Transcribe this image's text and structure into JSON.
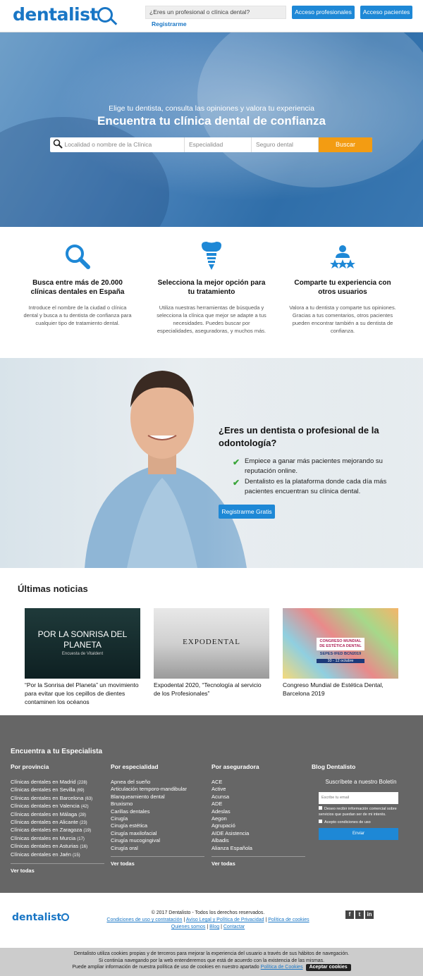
{
  "header": {
    "logo": "dentalist",
    "pro_question": "¿Eres un profesional o clínica dental?",
    "register": "Registrarme",
    "btn_pro": "Acceso profesionales",
    "btn_patients": "Acceso pacientes"
  },
  "hero": {
    "subtitle": "Elige tu dentista, consulta las opiniones y valora tu experiencia",
    "title": "Encuentra tu clínica dental de confianza",
    "search": {
      "location_placeholder": "Localidad o nombre de la Clínica",
      "specialty_placeholder": "Especialidad",
      "insurance_placeholder": "Seguro dental",
      "button": "Buscar"
    }
  },
  "features": [
    {
      "title": "Busca entre más de 20.000 clínicas dentales en España",
      "text": "Introduce el nombre de la ciudad o clínica dental y busca a tu dentista de confianza para cualquier tipo de tratamiento dental."
    },
    {
      "title": "Selecciona la mejor opción para tu tratamiento",
      "text": "Utiliza nuestras herramientas de búsqueda y selecciona la clínica que mejor se adapte a tus necesidades. Puedes buscar por especialidades, aseguradoras, y muchos más."
    },
    {
      "title": "Comparte tu experiencia con otros usuarios",
      "text": "Valora a tu dentista y comparte tus opiniones. Gracias a tus comentarios, otros pacientes pueden encontrar también a su dentista de confianza."
    }
  ],
  "dentist": {
    "title": "¿Eres un dentista o profesional de la odontología?",
    "point1": "Empiece a ganar más pacientes mejorando su reputación online.",
    "point2": "Dentalisto es la plataforma donde cada día más pacientes encuentran su clínica dental.",
    "button": "Registrarme Gratis"
  },
  "news": {
    "title": "Últimas noticias",
    "items": [
      {
        "img_text": "POR LA SONRISA DEL PLANETA",
        "img_sub": "Encuesta de Vitaldent",
        "caption": "“Por la Sonrisa del Planeta” un movimiento para evitar que los cepillos de dientes contaminen los océanos"
      },
      {
        "img_text": "EXPODENTAL",
        "caption": "Expodental 2020, “Tecnología al servicio de los Profesionales”"
      },
      {
        "img_text": "CONGRESO MUNDIAL DE ESTÉTICA DENTAL",
        "img_sub": "SEPES·IFED BCN2019",
        "img_date": "10 - 12 octubre",
        "caption": "Congreso Mundial de Estética Dental, Barcelona 2019"
      }
    ]
  },
  "footer": {
    "title": "Encuentra a tu Especialista",
    "provinces": {
      "heading": "Por provincia",
      "items": [
        {
          "name": "Clínicas dentales en Madrid",
          "count": "(228)"
        },
        {
          "name": "Clínicas dentales en Sevilla",
          "count": "(69)"
        },
        {
          "name": "Clínicas dentales en Barcelona",
          "count": "(63)"
        },
        {
          "name": "Clínicas dentales en Valencia",
          "count": "(42)"
        },
        {
          "name": "Clínicas dentales en Málaga",
          "count": "(28)"
        },
        {
          "name": "Clínicas dentales en Alicante",
          "count": "(23)"
        },
        {
          "name": "Clínicas dentales en Zaragoza",
          "count": "(19)"
        },
        {
          "name": "Clínicas dentales en Murcia",
          "count": "(17)"
        },
        {
          "name": "Clínicas dentales en Asturias",
          "count": "(16)"
        },
        {
          "name": "Clínicas dentales en Jaén",
          "count": "(15)"
        }
      ],
      "all": "Ver todas"
    },
    "specialties": {
      "heading": "Por especialidad",
      "items": [
        "Apnea del sueño",
        "Articulación temporo-mandibular",
        "Blanqueamiento dental",
        "Bruxismo",
        "Carillas dentales",
        "Cirugía",
        "Cirugía estética",
        "Cirugía maxilofacial",
        "Cirugía mucogingival",
        "Cirugía oral"
      ],
      "all": "Ver todas"
    },
    "insurers": {
      "heading": "Por aseguradora",
      "items": [
        "ACE",
        "Active",
        "Acunsa",
        "ADE",
        "Adeslas",
        "Aegon",
        "Agrupació",
        "AIDE Asistencia",
        "Albadis",
        "Alianza Española"
      ],
      "all": "Ver todas"
    },
    "blog": {
      "heading": "Blog Dentalisto",
      "subscribe": "Suscríbete a nuestro Boletín",
      "email_placeholder": "Escribe tu email",
      "opt1": "Deseo recibir información comercial sobre servicios que puedan ser de mi interés.",
      "opt2": "Acepto condiciones de uso",
      "send": "Enviar"
    }
  },
  "bottom": {
    "logo": "dentalist",
    "copyright": "© 2017 Dentalisto - Todos los derechos reservados.",
    "link1": "Condiciones de uso y contratación",
    "link2": "Aviso Legal y Política de Privacidad",
    "link3": "Política de cookies",
    "link4": "Quienes somos",
    "link5": "Blog",
    "link6": "Contactar",
    "social": [
      "f",
      "t",
      "in"
    ]
  },
  "cookies": {
    "line1": "Dentalisto utiliza cookies propias y de terceros para mejorar la experiencia del usuario a través de sus hábitos de navegación.",
    "line2": "Si continúa navegando por la web entenderemos que está de acuerdo con la existencia de las mismas.",
    "line3": "Puede ampliar información de nuestra política de uso de cookies en nuestro apartado",
    "link": "Política de Cookies",
    "accept": "Aceptar cookies"
  }
}
